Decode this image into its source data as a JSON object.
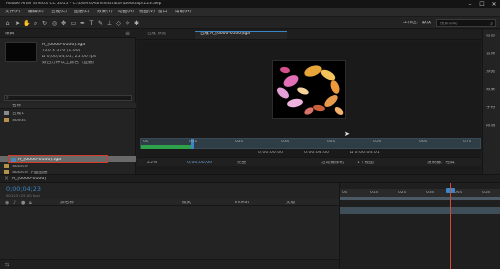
{
  "window": {
    "title": "Adobe After Effects CC 2015 - C:\\Users\\Administrator\\Desktop\\123.aep",
    "min": "–",
    "max": "☐",
    "close": "✕"
  },
  "menu": [
    "文件(F)",
    "编辑(E)",
    "合成(C)",
    "图层(L)",
    "效果(T)",
    "动画(A)",
    "视图(V)",
    "窗口",
    "帮助(H)"
  ],
  "toolbar": {
    "workspace_label": "工作区:",
    "workspace_value": "默认",
    "search_placeholder": "搜索帮助"
  },
  "project": {
    "panel_title": "项目",
    "item_name": "A_[0000-0100].tga",
    "item_info_1": "720 x 576 (1.00)",
    "item_info_2": "Δ 0;00;04;01, 25.00 fps",
    "item_info_3": "数百万种以上颜色（直通）",
    "column_name": "名称",
    "rows": [
      {
        "label": "合成1"
      },
      {
        "label": "Solids"
      },
      {
        "label": "A_[0000-0100].tga"
      },
      {
        "label": "Source"
      },
      {
        "label": "Source 下面图层"
      },
      {
        "label": "合成"
      }
    ],
    "bpc": "8 bpc"
  },
  "viewer": {
    "tab_layer": "合成 预览",
    "tab_comp": "合成 A_[0000-0100]tga",
    "zoom": "25%",
    "timecode": "0;00;00;00",
    "res": "完整",
    "time_start": "0:00:00:00",
    "time_end": "0:00:04:00",
    "duration": "Δ 0:00:04:01",
    "ruler_marks": [
      "0s",
      "01s",
      "02s",
      "03s",
      "04s",
      "05s",
      "06s",
      "07s"
    ],
    "view_label": "活动摄像机",
    "views": "1个视图",
    "renderer": "渲染器：经典"
  },
  "timeline": {
    "tab_label": "A_[0000-0100]",
    "timecode": "0;00;04;23",
    "fps_info": "00123 (25.00 fps)",
    "col_source": "源名称",
    "col_mode": "模式",
    "col_trkmat": "TrkMat",
    "col_parent": "父级",
    "ruler_marks": [
      "0s",
      "01s",
      "02s",
      "03s",
      "04s",
      "05s"
    ]
  },
  "right_panel": {
    "labels": [
      "信息",
      "音频",
      "预览",
      "效果",
      "字符",
      "段落"
    ]
  },
  "colors": {
    "accent_blue": "#3a86c6",
    "selection_red_box": "#d23a2a",
    "cti_red": "#d24b3a"
  }
}
